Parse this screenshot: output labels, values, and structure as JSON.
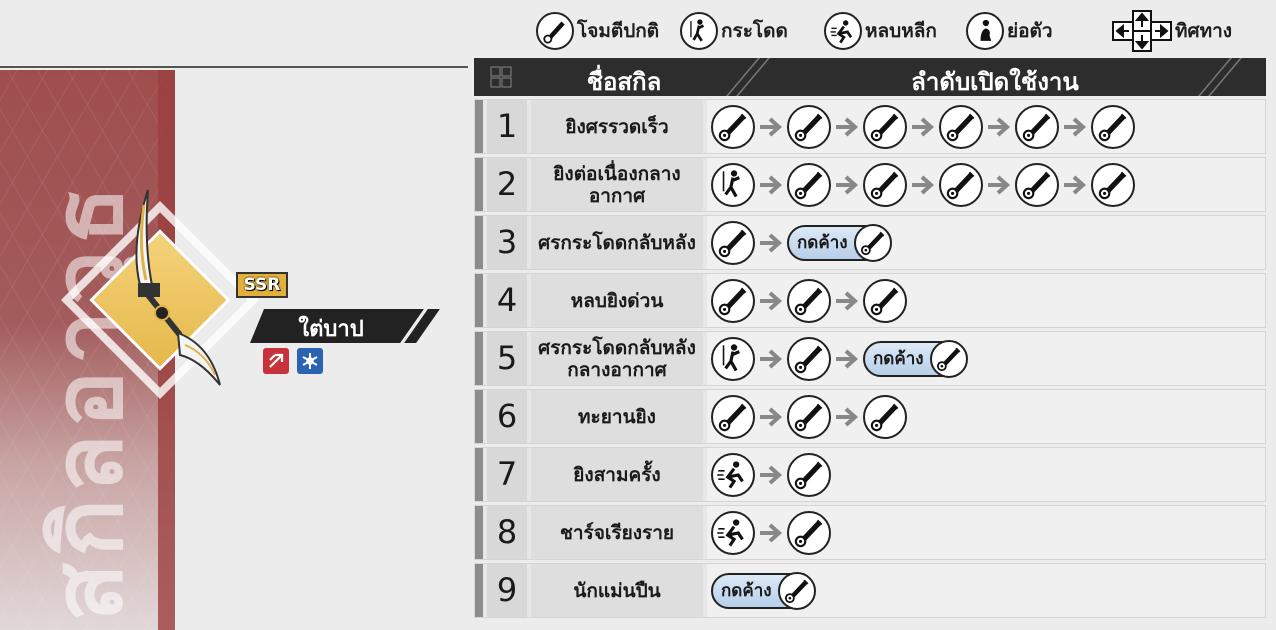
{
  "legend": [
    {
      "icon": "basic-attack-icon",
      "label": "โจมตีปกติ"
    },
    {
      "icon": "jump-icon",
      "label": "กระโดด"
    },
    {
      "icon": "dodge-icon",
      "label": "หลบหลีก"
    },
    {
      "icon": "crouch-icon",
      "label": "ย่อตัว"
    },
    {
      "icon": "direction-keys-icon",
      "label": "ทิศทาง"
    }
  ],
  "side_title": "สกิลอาวุธ",
  "weapon": {
    "rarity": "SSR",
    "name": "ใต่บาป",
    "elements": [
      "fire-element-icon",
      "ice-element-icon"
    ]
  },
  "table": {
    "header_name": "ชื่อสกิล",
    "header_order": "ลำดับเปิดใช้งาน",
    "hold_label": "กดค้าง",
    "rows": [
      {
        "num": "1",
        "name": "ยิงศรรวดเร็ว",
        "seq": [
          {
            "t": "atk"
          },
          {
            "t": "atk"
          },
          {
            "t": "atk"
          },
          {
            "t": "atk"
          },
          {
            "t": "atk"
          },
          {
            "t": "atk"
          }
        ]
      },
      {
        "num": "2",
        "name": "ยิงต่อเนื่องกลางอากาศ",
        "seq": [
          {
            "t": "jump"
          },
          {
            "t": "atk"
          },
          {
            "t": "atk"
          },
          {
            "t": "atk"
          },
          {
            "t": "atk"
          },
          {
            "t": "atk"
          }
        ]
      },
      {
        "num": "3",
        "name": "ศรกระโดดกลับหลัง",
        "seq": [
          {
            "t": "atk"
          },
          {
            "t": "hold"
          }
        ]
      },
      {
        "num": "4",
        "name": "หลบยิงด่วน",
        "seq": [
          {
            "t": "atk"
          },
          {
            "t": "atk"
          },
          {
            "t": "atk"
          }
        ]
      },
      {
        "num": "5",
        "name": "ศรกระโดดกลับหลังกลางอากาศ",
        "seq": [
          {
            "t": "jump"
          },
          {
            "t": "atk"
          },
          {
            "t": "hold"
          }
        ]
      },
      {
        "num": "6",
        "name": "ทะยานยิง",
        "seq": [
          {
            "t": "atk"
          },
          {
            "t": "atk"
          },
          {
            "t": "atk"
          }
        ]
      },
      {
        "num": "7",
        "name": "ยิงสามครั้ง",
        "seq": [
          {
            "t": "dodge"
          },
          {
            "t": "atk"
          }
        ]
      },
      {
        "num": "8",
        "name": "ชาร์จเรียงราย",
        "seq": [
          {
            "t": "dodge"
          },
          {
            "t": "atk"
          }
        ]
      },
      {
        "num": "9",
        "name": "นักแม่นปืน",
        "seq": [
          {
            "t": "hold"
          }
        ]
      }
    ]
  },
  "colors": {
    "accent_gold": "#e3b13b",
    "panel_red": "#a04d4d",
    "header_dark": "#2d2d2d",
    "hold_blue": "#b7cfe9"
  }
}
